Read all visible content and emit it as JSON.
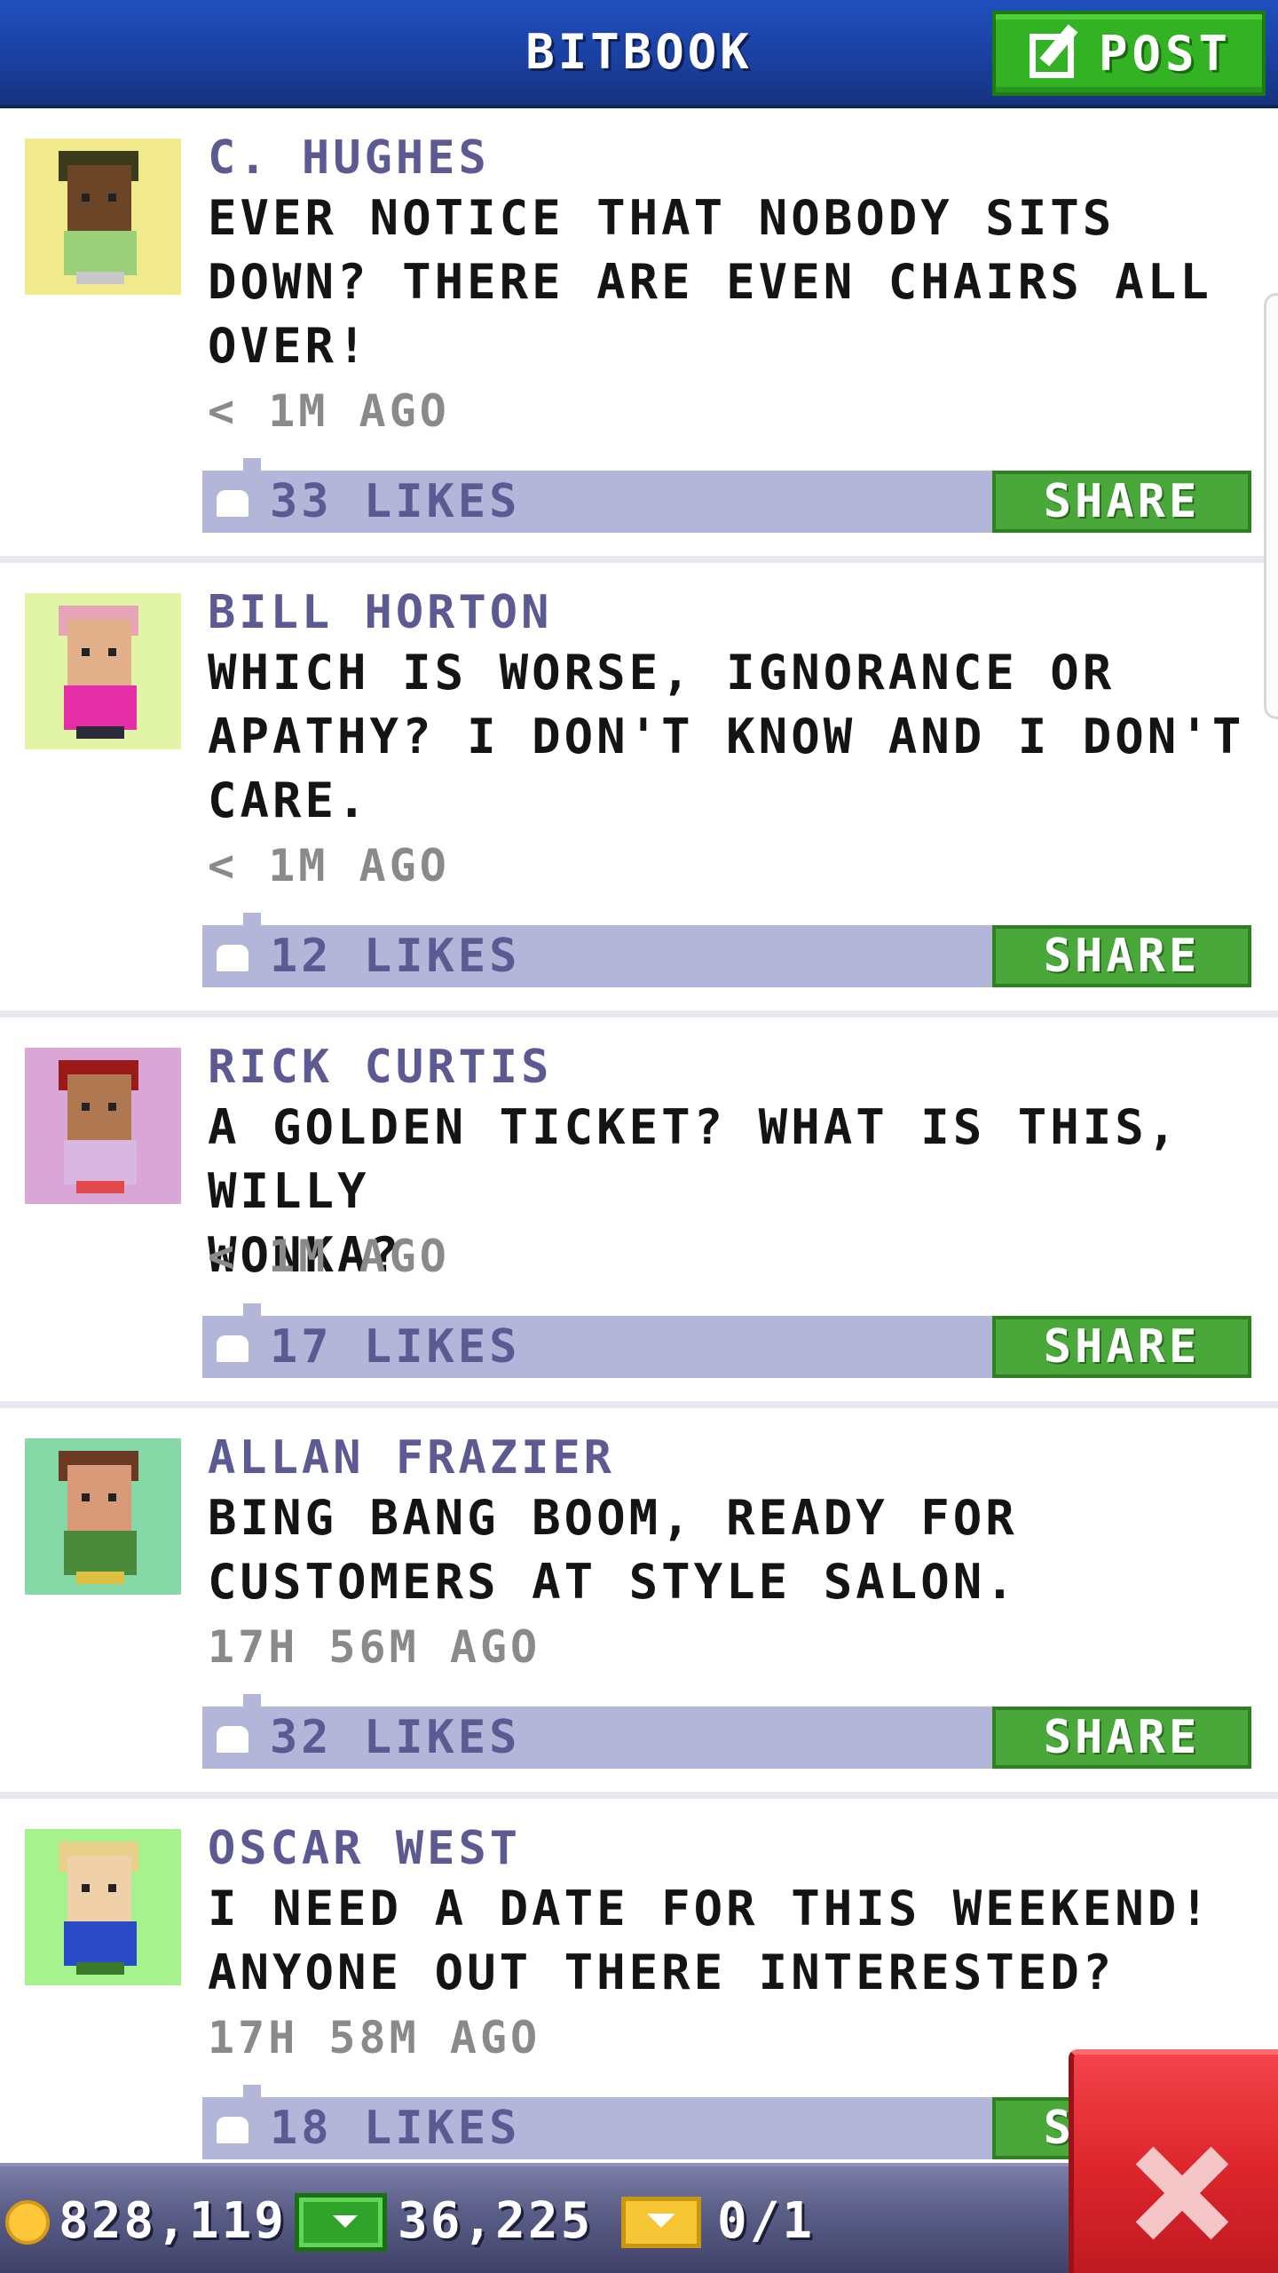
{
  "header": {
    "title": "BITBOOK",
    "post_label": "POST",
    "post_icon": "compose-icon",
    "bg_color": "#1a3f9e"
  },
  "posts": [
    {
      "author": "C. HUGHES",
      "message": "EVER NOTICE THAT NOBODY SITS\nDOWN? THERE ARE EVEN CHAIRS ALL\nOVER!",
      "time": "< 1M AGO",
      "likes": "33 LIKES",
      "share_label": "SHARE",
      "avatar_bg": "#f0ea8c"
    },
    {
      "author": "BILL HORTON",
      "message": "WHICH IS WORSE, IGNORANCE OR\nAPATHY? I DON'T KNOW AND I DON'T\nCARE.",
      "time": "< 1M AGO",
      "likes": "12 LIKES",
      "share_label": "SHARE",
      "avatar_bg": "#e2f4a6"
    },
    {
      "author": "RICK CURTIS",
      "message": "A GOLDEN TICKET? WHAT IS THIS, WILLY\nWONKA?",
      "time": "< 1M AGO",
      "likes": "17 LIKES",
      "share_label": "SHARE",
      "avatar_bg": "#d9a6d6"
    },
    {
      "author": "ALLAN FRAZIER",
      "message": "BING BANG BOOM, READY FOR\nCUSTOMERS AT STYLE SALON.",
      "time": "17H 56M AGO",
      "likes": "32 LIKES",
      "share_label": "SHARE",
      "avatar_bg": "#86d9a6"
    },
    {
      "author": "OSCAR WEST",
      "message": "I NEED A DATE FOR THIS WEEKEND!\nANYONE OUT THERE INTERESTED?",
      "time": "17H 58M AGO",
      "likes": "18 LIKES",
      "share_label": "SHARE",
      "avatar_bg": "#a6f28c"
    }
  ],
  "resources": {
    "coins": "828,119",
    "bux": "36,225",
    "tickets": "0/1"
  },
  "colors": {
    "author_text": "#5c5a92",
    "like_bar": "#b3b6d9",
    "share_button": "#4aa83a",
    "close_button": "#de262d"
  }
}
